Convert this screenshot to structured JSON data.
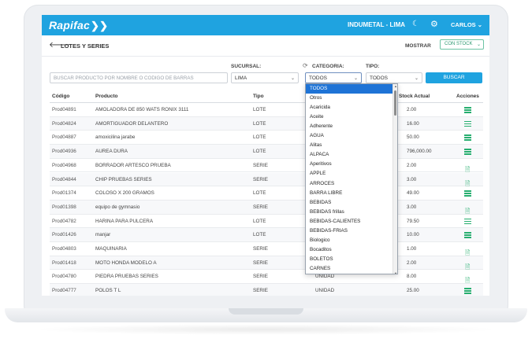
{
  "header": {
    "logo": "Rapifac",
    "company": "INDUMETAL - LIMA",
    "user": "CARLOS ⌄",
    "colors": {
      "topbar": "#1fa3e0",
      "accent_green": "#27ae6f"
    }
  },
  "titlebar": {
    "title": "LOTES Y SERIES",
    "mostrar_label": "MOSTRAR",
    "stock_option": "CON STOCK"
  },
  "filters": {
    "search_placeholder": "BUSCAR PRODUCTO POR NOMBRE O CODIGO DE BARRAS",
    "sucursal_label": "SUCURSAL:",
    "sucursal_value": "LIMA",
    "categoria_label": "CATEGORIA:",
    "categoria_value": "TODOS",
    "tipo_label": "TIPO:",
    "tipo_value": "TODOS",
    "button": "BUSCAR"
  },
  "table": {
    "headers": [
      "Código",
      "Producto",
      "Tipo",
      "Stock Actual",
      "Acciones"
    ],
    "rows": [
      {
        "code": "Prod04891",
        "product": "AMOLADORA DE 850 WATS RONIX 3111",
        "type": "LOTE",
        "unit": "",
        "stock": "2.00",
        "action": "list-icon"
      },
      {
        "code": "Prod04824",
        "product": "AMORTIGUADOR DELANTERO",
        "type": "LOTE",
        "unit": "",
        "stock": "16.00",
        "action": "list-icon"
      },
      {
        "code": "Prod04887",
        "product": "amoxicilina jarabe",
        "type": "LOTE",
        "unit": "",
        "stock": "50.00",
        "action": "list-icon"
      },
      {
        "code": "Prod04936",
        "product": "AUREA DURA",
        "type": "LOTE",
        "unit": "",
        "stock": "796,000.00",
        "action": "list-icon"
      },
      {
        "code": "Prod04968",
        "product": "BORRADOR ARTESCO PRUEBA",
        "type": "SERIE",
        "unit": "",
        "stock": "2.00",
        "action": "doc-icon"
      },
      {
        "code": "Prod04844",
        "product": "CHIP PRUEBAS SERIES",
        "type": "SERIE",
        "unit": "",
        "stock": "3.00",
        "action": "doc-icon"
      },
      {
        "code": "Prod01374",
        "product": "COLOSO X 200 GRAMOS",
        "type": "LOTE",
        "unit": "",
        "stock": "49.00",
        "action": "list-icon"
      },
      {
        "code": "Prod01398",
        "product": "equipo de gymnasio",
        "type": "SERIE",
        "unit": "",
        "stock": "3.00",
        "action": "doc-icon"
      },
      {
        "code": "Prod04782",
        "product": "HARINA PARA PULCERA",
        "type": "LOTE",
        "unit": "",
        "stock": "79.50",
        "action": "list-icon"
      },
      {
        "code": "Prod01426",
        "product": "manjar",
        "type": "LOTE",
        "unit": "",
        "stock": "10.00",
        "action": "list-icon"
      },
      {
        "code": "Prod04803",
        "product": "MAQUINARIA",
        "type": "SERIE",
        "unit": "",
        "stock": "1.00",
        "action": "doc-icon"
      },
      {
        "code": "Prod01418",
        "product": "MOTO HONDA MODELO A",
        "type": "SERIE",
        "unit": "",
        "stock": "2.00",
        "action": "doc-icon"
      },
      {
        "code": "Prod04780",
        "product": "PIEDRA PRUEBAS SERIES",
        "type": "SERIE",
        "unit": "UNIDAD",
        "stock": "8.00",
        "action": "doc-icon"
      },
      {
        "code": "Prod04777",
        "product": "POLOS T L",
        "type": "SERIE",
        "unit": "UNIDAD",
        "stock": "25.00",
        "action": "list-icon"
      }
    ]
  },
  "category_dropdown": {
    "options": [
      "TODOS",
      "Otros",
      "Acaricida",
      "Aceite",
      "Adherente",
      "AGUA",
      "Alitas",
      "ALPACA",
      "Aperitivos",
      "APPLE",
      "ARROCES",
      "BARRA LIBRE",
      "BEBIDAS",
      "BEBIDAS frillas",
      "BEBIDAS-CALIENTES",
      "BEBIDAS-FRIAS",
      "Biologico",
      "Bocaditos",
      "BOLETOS",
      "CARNES"
    ],
    "selected": "TODOS"
  }
}
